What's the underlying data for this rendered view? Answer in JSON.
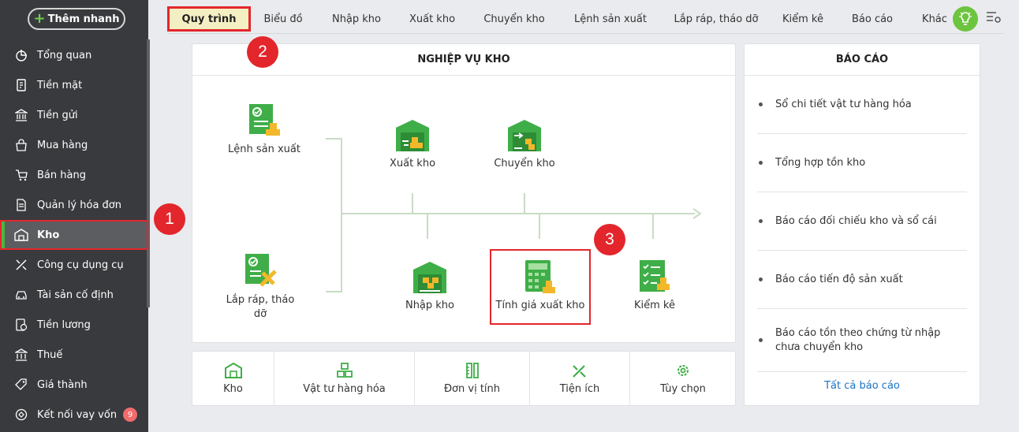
{
  "sidebar": {
    "quick_add": "Thêm nhanh",
    "items": [
      {
        "label": "Tổng quan",
        "icon": "pie-chart-icon"
      },
      {
        "label": "Tiền mặt",
        "icon": "cash-icon"
      },
      {
        "label": "Tiền gửi",
        "icon": "bank-icon"
      },
      {
        "label": "Mua hàng",
        "icon": "shopping-bag-icon"
      },
      {
        "label": "Bán hàng",
        "icon": "cart-icon"
      },
      {
        "label": "Quản lý hóa đơn",
        "icon": "invoice-icon"
      },
      {
        "label": "Kho",
        "icon": "warehouse-icon",
        "active": true
      },
      {
        "label": "Công cụ dụng cụ",
        "icon": "tools-icon"
      },
      {
        "label": "Tài sản cố định",
        "icon": "car-icon"
      },
      {
        "label": "Tiền lương",
        "icon": "salary-icon"
      },
      {
        "label": "Thuế",
        "icon": "tax-icon"
      },
      {
        "label": "Giá thành",
        "icon": "price-tag-icon"
      },
      {
        "label": "Kết nối vay vốn",
        "icon": "loan-icon",
        "badge": "9"
      }
    ]
  },
  "tabs": [
    {
      "label": "Quy trình",
      "selected": true
    },
    {
      "label": "Biểu đồ"
    },
    {
      "label": "Nhập kho"
    },
    {
      "label": "Xuất kho"
    },
    {
      "label": "Chuyển kho"
    },
    {
      "label": "Lệnh sản xuất"
    },
    {
      "label": "Lắp ráp, tháo dỡ"
    },
    {
      "label": "Kiểm kê"
    },
    {
      "label": "Báo cáo"
    },
    {
      "label": "Khác"
    }
  ],
  "process": {
    "title": "NGHIỆP VỤ KHO",
    "nodes": {
      "lenh_san_xuat": "Lệnh sản xuất",
      "lap_rap": "Lắp ráp, tháo\ndỡ",
      "xuat_kho": "Xuất kho",
      "chuyen_kho": "Chuyển kho",
      "nhap_kho": "Nhập kho",
      "tinh_gia": "Tính giá xuất kho",
      "kiem_ke": "Kiểm kê"
    }
  },
  "shortcuts": [
    {
      "label": "Kho",
      "icon": "warehouse-icon"
    },
    {
      "label": "Vật tư hàng hóa",
      "icon": "goods-icon"
    },
    {
      "label": "Đơn vị tính",
      "icon": "ruler-icon"
    },
    {
      "label": "Tiện ích",
      "icon": "utilities-icon"
    },
    {
      "label": "Tùy chọn",
      "icon": "settings-icon"
    }
  ],
  "reports": {
    "title": "BÁO CÁO",
    "items": [
      "Sổ chi tiết vật tư hàng hóa",
      "Tổng hợp tồn kho",
      "Báo cáo đối chiếu kho và sổ cái",
      "Báo cáo tiến độ sản xuất",
      "Báo cáo tồn theo chứng từ nhập chưa chuyển kho"
    ],
    "all_link": "Tất cả báo cáo"
  },
  "annotations": [
    "1",
    "2",
    "3"
  ],
  "colors": {
    "accent": "#4bb543",
    "highlight": "#e3262b",
    "sidebar": "#393a3d"
  }
}
